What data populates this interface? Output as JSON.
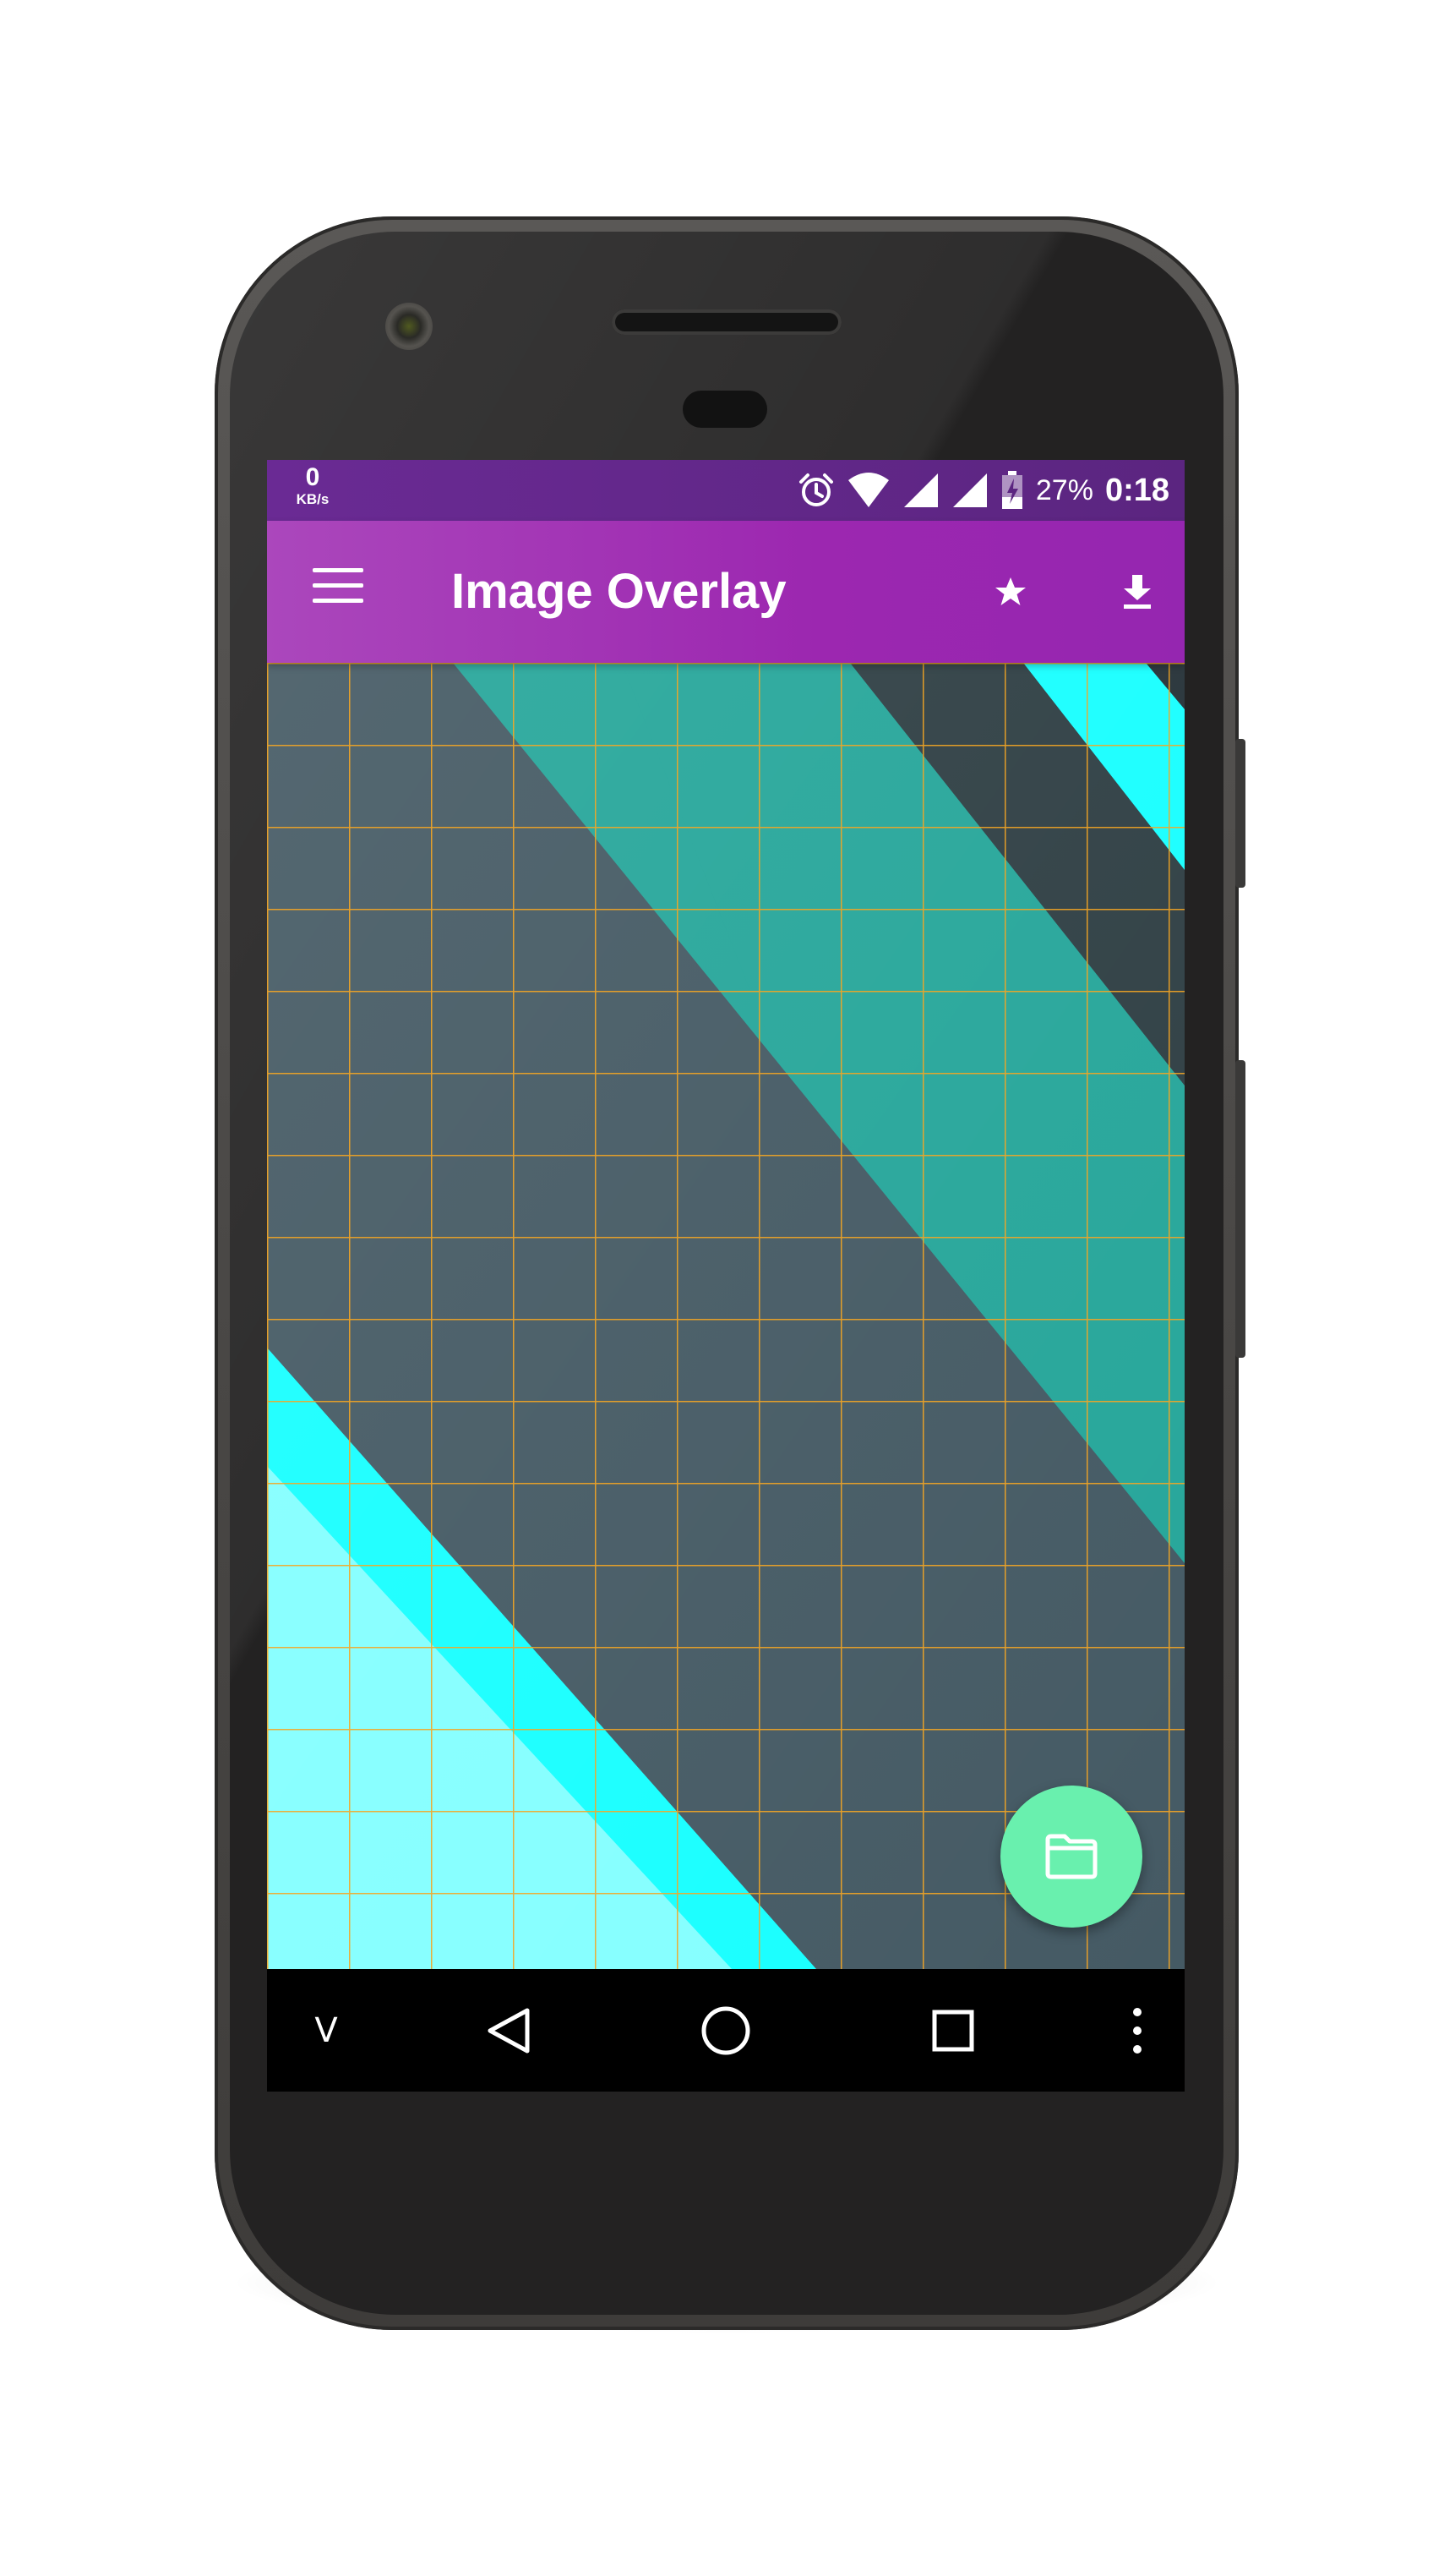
{
  "status_bar": {
    "net_speed_value": "0",
    "net_speed_unit": "KB/s",
    "battery_percent": "27%",
    "time": "0:18",
    "icons": [
      "alarm-icon",
      "wifi-icon",
      "signal-icon",
      "signal-icon",
      "battery-charging-icon"
    ]
  },
  "app_bar": {
    "title": "Image Overlay",
    "menu_icon": "menu-icon",
    "actions": [
      "star-icon",
      "download-icon"
    ]
  },
  "overlay": {
    "grid_color": "#f5a623",
    "wallpaper_colors": [
      "#455a64",
      "#26a69a",
      "#37474f",
      "#18ffff",
      "#84ffff"
    ]
  },
  "fab": {
    "icon": "folder-icon",
    "color": "#69f0ae"
  },
  "nav_bar": {
    "collapse_label": "V",
    "icons": [
      "back-icon",
      "home-icon",
      "recents-icon",
      "more-icon"
    ]
  },
  "colors": {
    "status_bar": "#6a2a94",
    "app_bar": "#9c27b0",
    "nav_bar": "#000000"
  }
}
